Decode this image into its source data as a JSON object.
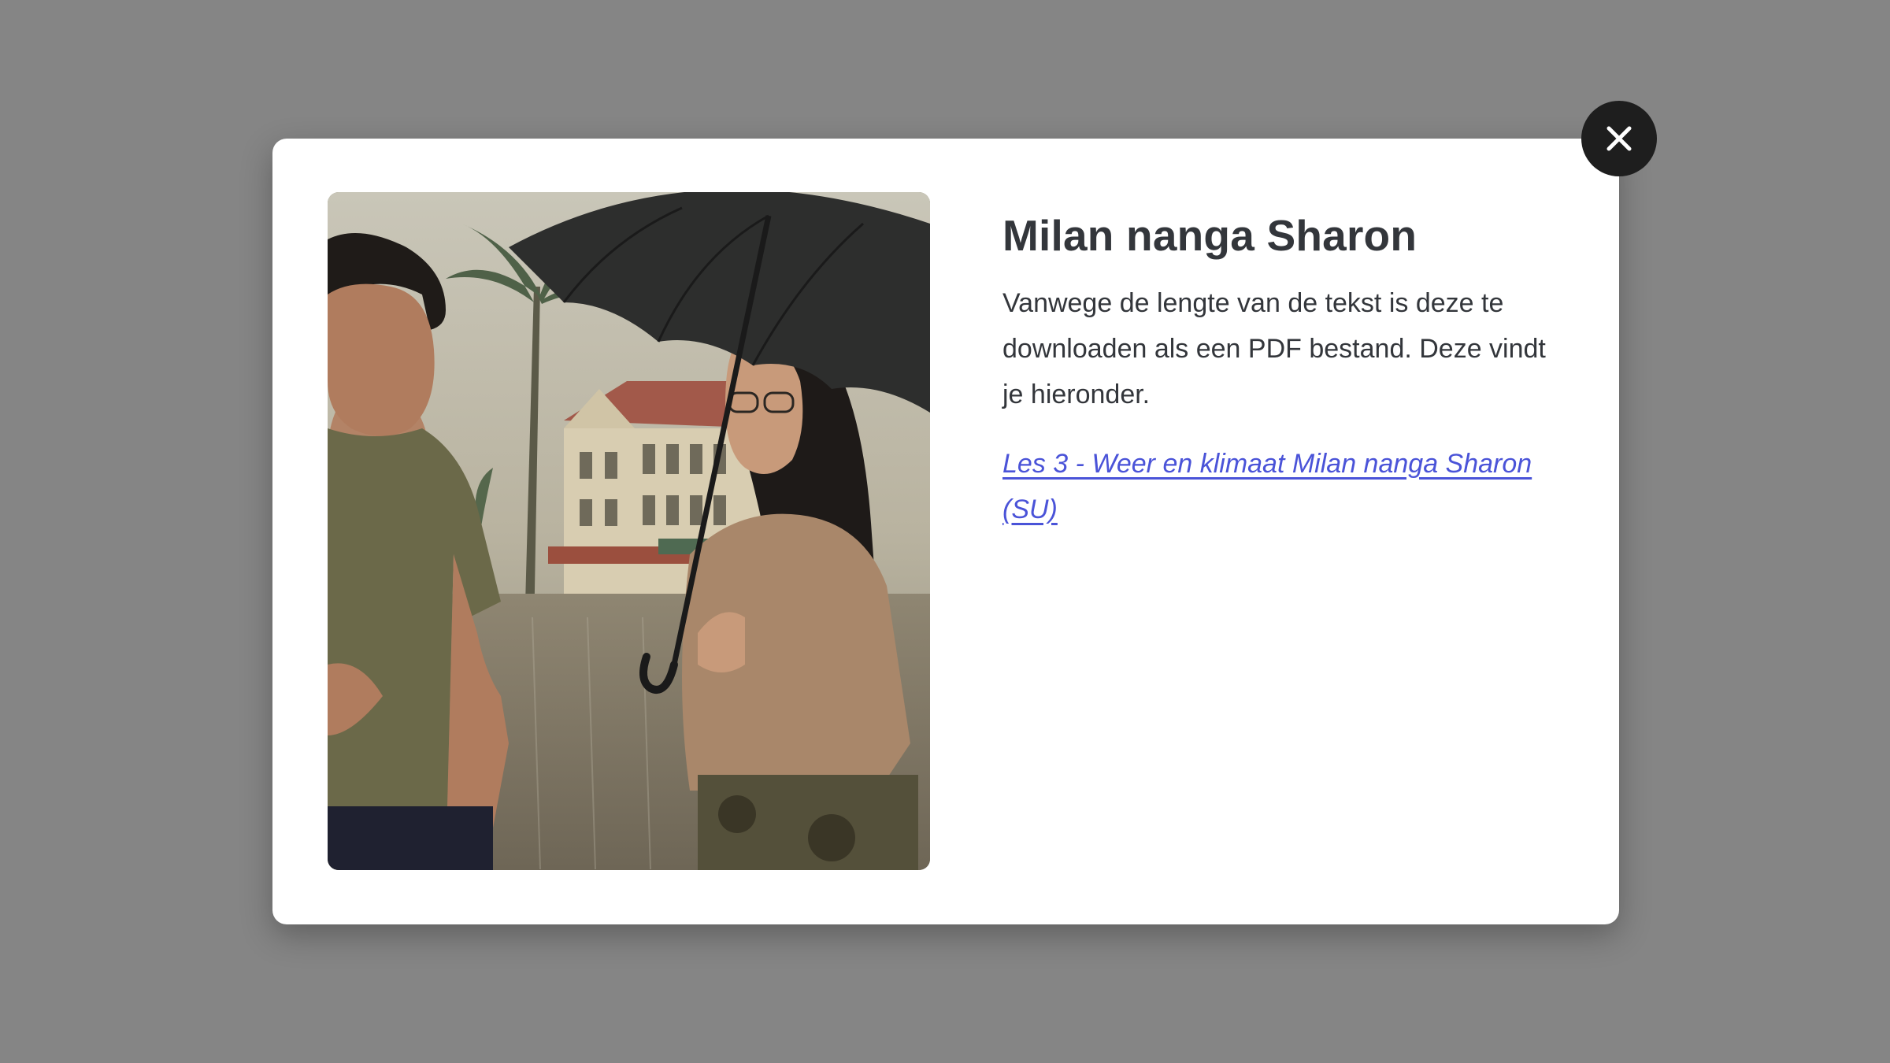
{
  "modal": {
    "title": "Milan nanga Sharon",
    "body": "Vanwege de lengte van de tekst is deze te downloaden als een PDF bestand. Deze vindt je hieronder.",
    "link_label": "Les 3 - Weer en klimaat Milan nanga Sharon (SU)",
    "image_alt": "Milan nanga Sharon",
    "close_icon": "close-icon"
  },
  "colors": {
    "overlay": "#858585",
    "modal_background": "#ffffff",
    "text": "#33363b",
    "link": "#4a53d8",
    "close_button": "#1e1e1e"
  }
}
